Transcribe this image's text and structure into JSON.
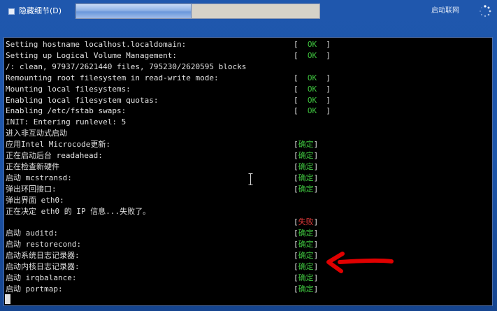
{
  "toolbar": {
    "collapse_label": "隐藏细节(D)",
    "boot_label": "启动联网",
    "progress": 0.47
  },
  "console": {
    "lines": [
      {
        "text": "Setting hostname localhost.localdomain:",
        "status": "OK",
        "status_kind": "ok"
      },
      {
        "text": "Setting up Logical Volume Management:",
        "status": "OK",
        "status_kind": "ok"
      },
      {
        "text": "/: clean, 97937/2621440 files, 795230/2620595 blocks",
        "status": "",
        "status_kind": "none"
      },
      {
        "text": "Remounting root filesystem in read-write mode:",
        "status": "OK",
        "status_kind": "ok"
      },
      {
        "text": "Mounting local filesystems:",
        "status": "OK",
        "status_kind": "ok"
      },
      {
        "text": "Enabling local filesystem quotas:",
        "status": "OK",
        "status_kind": "ok"
      },
      {
        "text": "Enabling /etc/fstab swaps:",
        "status": "OK",
        "status_kind": "ok"
      },
      {
        "text": "INIT: Entering runlevel: 5",
        "status": "",
        "status_kind": "none"
      },
      {
        "text": "进入非互动式启动",
        "status": "",
        "status_kind": "none"
      },
      {
        "text": "应用Intel Microcode更新:",
        "status": "确定",
        "status_kind": "ok"
      },
      {
        "text": "正在启动后台 readahead:",
        "status": "确定",
        "status_kind": "ok"
      },
      {
        "text": "正在检查新硬件",
        "status": "确定",
        "status_kind": "ok"
      },
      {
        "text": "启动 mcstransd:",
        "status": "确定",
        "status_kind": "ok"
      },
      {
        "text": "弹出环回接口:",
        "status": "确定",
        "status_kind": "ok"
      },
      {
        "text": "弹出界面 eth0:",
        "status": "",
        "status_kind": "none"
      },
      {
        "text": "正在决定 eth0 的 IP 信息...失败了。",
        "status": "",
        "status_kind": "none"
      },
      {
        "text": "",
        "status": "失败",
        "status_kind": "fail"
      },
      {
        "text": "启动 auditd:",
        "status": "确定",
        "status_kind": "ok"
      },
      {
        "text": "启动 restorecond:",
        "status": "确定",
        "status_kind": "ok"
      },
      {
        "text": "启动系统日志记录器:",
        "status": "确定",
        "status_kind": "ok"
      },
      {
        "text": "启动内核日志记录器:",
        "status": "确定",
        "status_kind": "ok"
      },
      {
        "text": "启动 irqbalance:",
        "status": "确定",
        "status_kind": "ok"
      },
      {
        "text": "启动 portmap:",
        "status": "确定",
        "status_kind": "ok"
      }
    ]
  },
  "colors": {
    "background": "#1d56ab",
    "console_bg": "#000000",
    "ok": "#3ec43e",
    "fail": "#e23a3a",
    "annotation_arrow": "#e00000"
  },
  "icons": [
    "collapse-icon",
    "spinner-icon",
    "text-cursor-icon",
    "ibeam-cursor-icon",
    "red-arrow-icon"
  ]
}
